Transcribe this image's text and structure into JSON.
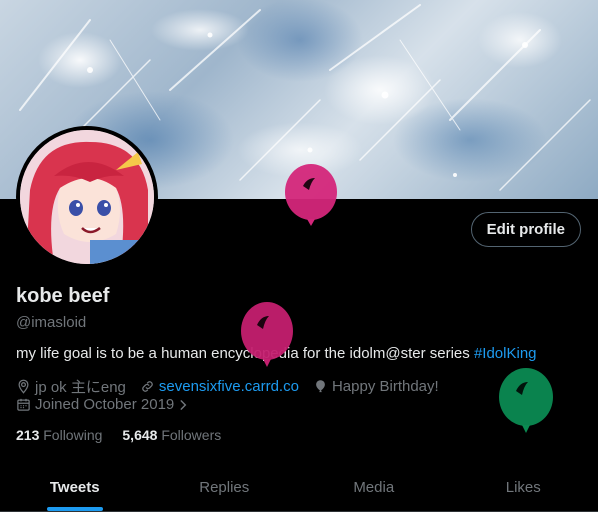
{
  "profile": {
    "edit_label": "Edit profile",
    "display_name": "kobe beef",
    "handle": "@imasloid",
    "bio_text": "my life goal is to be a human encyclopedia for the idolm@ster series ",
    "bio_hashtag": "#IdolKing",
    "location": "jp ok 主にeng",
    "website": "sevensixfive.carrd.co",
    "birthday": "Happy Birthday!",
    "joined": "Joined October 2019",
    "following_count": "213",
    "following_label": "Following",
    "followers_count": "5,648",
    "followers_label": "Followers"
  },
  "tabs": [
    {
      "label": "Tweets",
      "active": true
    },
    {
      "label": "Replies",
      "active": false
    },
    {
      "label": "Media",
      "active": false
    },
    {
      "label": "Likes",
      "active": false
    }
  ],
  "colors": {
    "accent": "#1d9bf0",
    "balloon_pink": "#d4267a",
    "balloon_green": "#0b8a52"
  },
  "icons": [
    "location-icon",
    "link-icon",
    "balloon-icon",
    "calendar-icon",
    "chevron-right-icon"
  ]
}
